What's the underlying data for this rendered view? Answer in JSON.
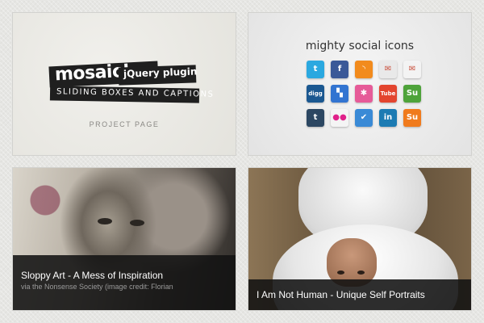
{
  "tiles": {
    "mosaic": {
      "logo_word": "mosaic",
      "logo_mark": "!",
      "plugin_label": "jQuery plugin",
      "subtitle": "SLIDING BOXES AND CAPTIONS",
      "project_link": "PROJECT PAGE"
    },
    "social": {
      "title": "mighty social icons",
      "icons": [
        {
          "name": "twitter-icon",
          "glyph": "t",
          "color": "#2aa8e0"
        },
        {
          "name": "facebook-icon",
          "glyph": "f",
          "color": "#3b5998"
        },
        {
          "name": "rss-icon",
          "glyph": "◝",
          "color": "#f28b1d"
        },
        {
          "name": "mail-icon",
          "glyph": "✉",
          "color": "#e9e9e9"
        },
        {
          "name": "email-icon",
          "glyph": "✉",
          "color": "#f3f3f3"
        },
        {
          "name": "digg-icon",
          "glyph": "digg",
          "color": "#1b5891"
        },
        {
          "name": "delicious-icon",
          "glyph": "▚",
          "color": "#3274d1"
        },
        {
          "name": "dribbble-icon",
          "glyph": "✱",
          "color": "#e65b98"
        },
        {
          "name": "youtube-icon",
          "glyph": "Tube",
          "color": "#e3452f"
        },
        {
          "name": "stumbleupon-icon",
          "glyph": "Su",
          "color": "#4ea33a"
        },
        {
          "name": "tumblr-icon",
          "glyph": "t",
          "color": "#2c4762"
        },
        {
          "name": "flickr-icon",
          "glyph": "●●",
          "color": "#f4f4f4"
        },
        {
          "name": "checkmark-icon",
          "glyph": "✔",
          "color": "#3a8ad6"
        },
        {
          "name": "linkedin-icon",
          "glyph": "in",
          "color": "#1c7bb3"
        },
        {
          "name": "stumble-orange-icon",
          "glyph": "Su",
          "color": "#f07b1d"
        }
      ]
    },
    "sloppy": {
      "title": "Sloppy Art - A Mess of Inspiration",
      "subtitle": "via the Nonsense Society (image credit: Florian"
    },
    "human": {
      "title": "I Am Not Human - Unique Self Portraits"
    }
  }
}
